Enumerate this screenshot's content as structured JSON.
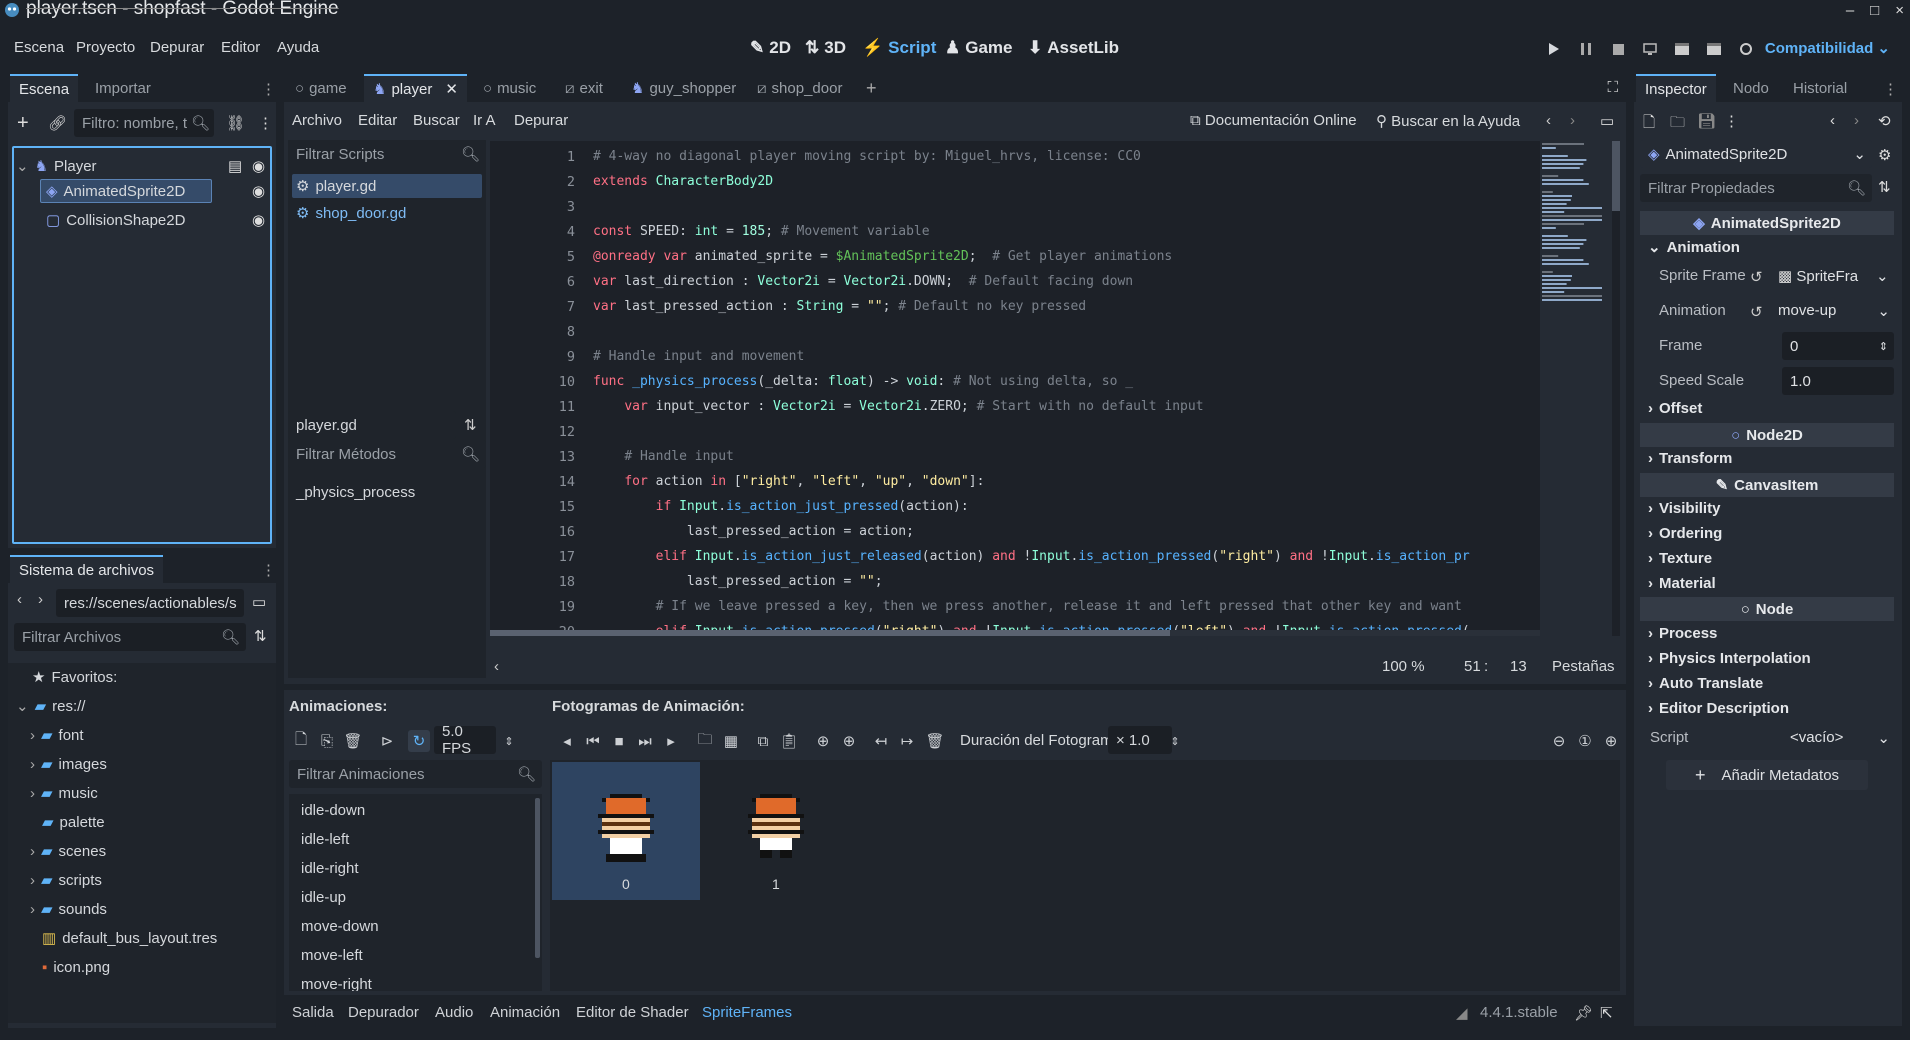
{
  "window": {
    "title": "player.tscn - shopfast - Godot Engine",
    "controls": [
      "–",
      "□",
      "×"
    ]
  },
  "menu": [
    "Escena",
    "Proyecto",
    "Depurar",
    "Editor",
    "Ayuda"
  ],
  "workspaces": [
    "2D",
    "3D",
    "Script",
    "Game",
    "AssetLib"
  ],
  "renderer": "Compatibilidad",
  "scene_dock": {
    "tabs": [
      "Escena",
      "Importar"
    ],
    "filter_placeholder": "Filtro: nombre, t",
    "nodes": [
      "Player",
      "AnimatedSprite2D",
      "CollisionShape2D"
    ]
  },
  "filesystem": {
    "title": "Sistema de archivos",
    "path": "res://scenes/actionables/s",
    "filter_placeholder": "Filtrar Archivos",
    "items": [
      "Favoritos:",
      "res://",
      "font",
      "images",
      "music",
      "palette",
      "scenes",
      "scripts",
      "sounds",
      "default_bus_layout.tres",
      "icon.png"
    ]
  },
  "editor_tabs": [
    "game",
    "player",
    "music",
    "exit",
    "guy_shopper",
    "shop_door"
  ],
  "script_menu": [
    "Archivo",
    "Editar",
    "Buscar",
    "Ir A",
    "Depurar"
  ],
  "doc_links": [
    "Documentación Online",
    "Buscar en la Ayuda"
  ],
  "scripts_panel": {
    "filter_placeholder": "Filtrar Scripts",
    "scripts": [
      "player.gd",
      "shop_door.gd"
    ],
    "current": "player.gd",
    "methods_placeholder": "Filtrar Métodos",
    "methods": [
      "_physics_process"
    ]
  },
  "code_lines": [
    "# 4-way no diagonal player moving script by: Miguel_hrvs, license: CC0",
    "extends CharacterBody2D",
    "",
    "const SPEED: int = 185; # Movement variable",
    "@onready var animated_sprite = $AnimatedSprite2D;  # Get player animations",
    "var last_direction : Vector2i = Vector2i.DOWN;  # Default facing down",
    "var last_pressed_action : String = \"\"; # Default no key pressed",
    "",
    "# Handle input and movement",
    "func _physics_process(_delta: float) -> void: # Not using delta, so _",
    "    var input_vector : Vector2i = Vector2i.ZERO; # Start with no default input",
    "",
    "    # Handle input",
    "    for action in [\"right\", \"left\", \"up\", \"down\"]:",
    "        if Input.is_action_just_pressed(action):",
    "            last_pressed_action = action;",
    "        elif Input.is_action_just_released(action) and !Input.is_action_pressed(\"right\") and !Input.is_action_pr",
    "            last_pressed_action = \"\";",
    "        # If we leave pressed a key, then we press another, release it and left pressed that other key and want",
    "        elif Input.is_action_pressed(\"right\") and !Input.is_action_pressed(\"left\") and !Input.is_action_pressed("
  ],
  "code_status": {
    "zoom": "100 %",
    "line": "51",
    "col": "13",
    "indent": "Pestañas"
  },
  "spriteframes": {
    "anim_title": "Animaciones:",
    "frames_title": "Fotogramas de Animación:",
    "fps": "5.0 FPS",
    "filter_placeholder": "Filtrar Animaciones",
    "animations": [
      "idle-down",
      "idle-left",
      "idle-right",
      "idle-up",
      "move-down",
      "move-left",
      "move-right"
    ],
    "duration_label": "Duración del Fotograma:",
    "duration_value": "× 1.0",
    "frames": [
      "0",
      "1"
    ]
  },
  "bottom_tabs": [
    "Salida",
    "Depurador",
    "Audio",
    "Animación",
    "Editor de Shader",
    "SpriteFrames"
  ],
  "version": "4.4.1.stable",
  "inspector": {
    "tabs": [
      "Inspector",
      "Nodo",
      "Historial"
    ],
    "object": "AnimatedSprite2D",
    "filter_placeholder": "Filtrar Propiedades",
    "header": "AnimatedSprite2D",
    "section_animation": "Animation",
    "props": [
      {
        "label": "Sprite Frame",
        "value": "SpriteFra"
      },
      {
        "label": "Animation",
        "value": "move-up"
      },
      {
        "label": "Frame",
        "value": "0"
      },
      {
        "label": "Speed Scale",
        "value": "1.0"
      }
    ],
    "offset": "Offset",
    "node2d": "Node2D",
    "transform": "Transform",
    "canvasitem": "CanvasItem",
    "ci_sections": [
      "Visibility",
      "Ordering",
      "Texture",
      "Material"
    ],
    "node": "Node",
    "node_sections": [
      "Process",
      "Physics Interpolation",
      "Auto Translate",
      "Editor Description"
    ],
    "script_label": "Script",
    "script_value": "<vacío>",
    "add_meta": "Añadir Metadatos"
  },
  "colors": {
    "accent": "#5fb3f7",
    "bg": "#1d2229",
    "panel": "#252b34"
  }
}
